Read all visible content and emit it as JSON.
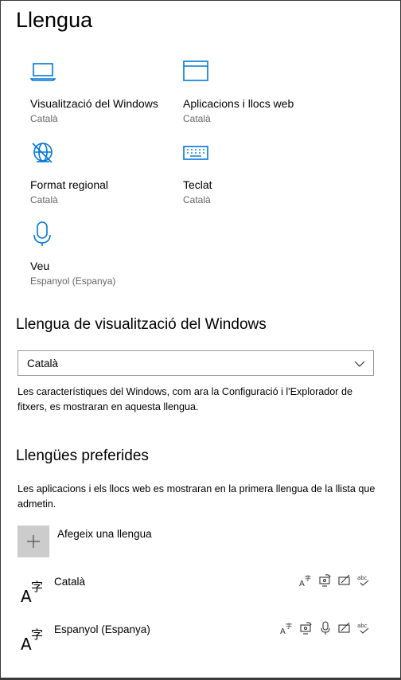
{
  "page": {
    "title": "Llengua"
  },
  "tiles": [
    {
      "title": "Visualització del Windows",
      "subtitle": "Català",
      "icon": "laptop-icon"
    },
    {
      "title": "Aplicacions i llocs web",
      "subtitle": "Català",
      "icon": "browser-window-icon"
    },
    {
      "title": "Format regional",
      "subtitle": "Català",
      "icon": "globe-icon"
    },
    {
      "title": "Teclat",
      "subtitle": "Català",
      "icon": "keyboard-icon"
    },
    {
      "title": "Veu",
      "subtitle": "Espanyol (Espanya)",
      "icon": "microphone-icon"
    }
  ],
  "display_language": {
    "heading": "Llengua de visualització del Windows",
    "selected": "Català",
    "description": "Les característiques del Windows, com ara la Configuració i l'Explorador de fitxers, es mostraran en aquesta llengua."
  },
  "preferred": {
    "heading": "Llengües preferides",
    "description": "Les aplicacions i els llocs web es mostraran en la primera llengua de la llista que admetin.",
    "add_label": "Afegeix una llengua",
    "languages": [
      {
        "name": "Català",
        "capabilities": [
          "language-pack-icon",
          "speech-display-icon",
          "handwriting-icon",
          "spellcheck-icon"
        ]
      },
      {
        "name": "Espanyol (Espanya)",
        "capabilities": [
          "language-pack-icon",
          "speech-display-icon",
          "microphone-icon",
          "handwriting-icon",
          "spellcheck-icon"
        ]
      }
    ]
  },
  "colors": {
    "accent": "#0078d7",
    "subtext": "#666666",
    "add_button_bg": "#cccccc"
  }
}
